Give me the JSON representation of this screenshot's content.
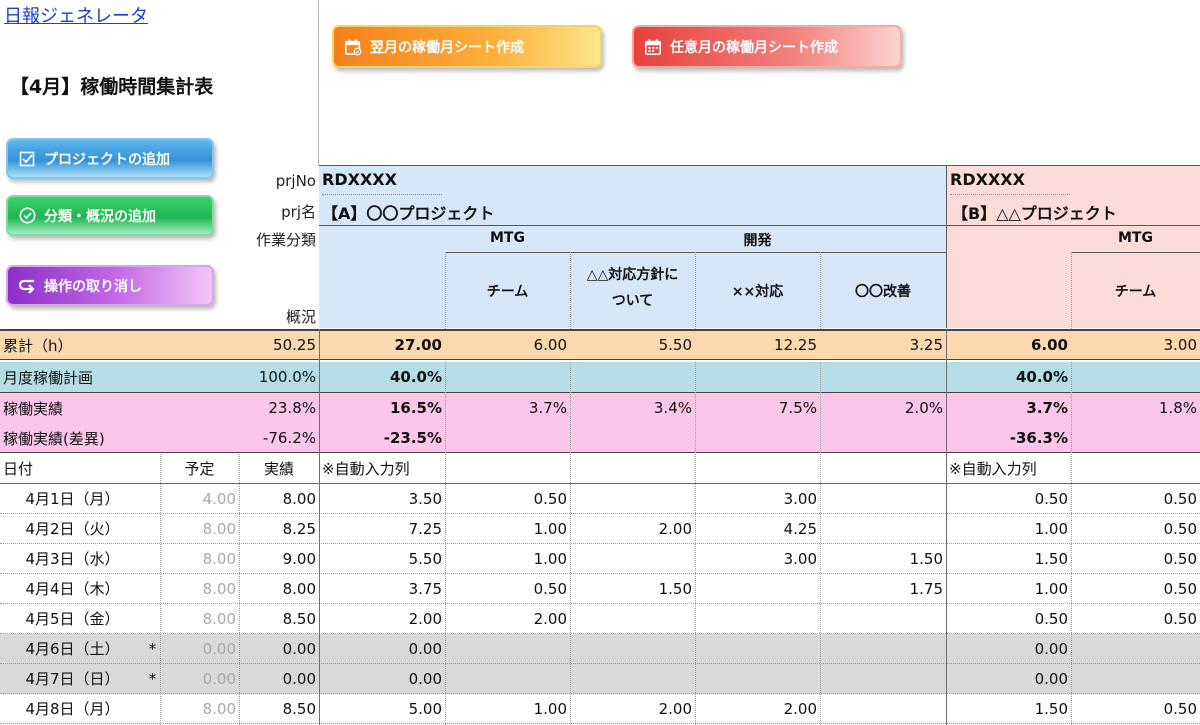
{
  "header": {
    "app_link": "日報ジェネレータ",
    "sheet_title": "【4月】稼働時間集計表"
  },
  "buttons": {
    "add_project": "プロジェクトの追加",
    "add_category": "分類・概況の追加",
    "undo": "操作の取り消し",
    "next_month_sheet": "翌月の稼働月シート作成",
    "any_month_sheet": "任意月の稼働月シート作成"
  },
  "labels": {
    "prj_no": "prjNo",
    "prj_name": "prj名",
    "work_category": "作業分類",
    "status": "概況"
  },
  "projects": {
    "a": {
      "no": "RDXXXX",
      "name": "【A】〇〇プロジェクト"
    },
    "b": {
      "no": "RDXXXX",
      "name": "【B】△△プロジェクト"
    }
  },
  "categories": {
    "a_mtg": "MTG",
    "a_dev": "開発",
    "b_mtg": "MTG"
  },
  "statuses": {
    "a_team": "チーム",
    "a_policy": "△△対応方針に\nついて",
    "a_xx": "××対応",
    "a_oo": "〇〇改善",
    "b_team": "チーム"
  },
  "summary": {
    "total": {
      "label": "累計（h）",
      "sum": "50.25",
      "a_total": "27.00",
      "a_team": "6.00",
      "a_policy": "5.50",
      "a_xx": "12.25",
      "a_oo": "3.25",
      "b_total": "6.00",
      "b_team": "3.00"
    },
    "plan": {
      "label": "月度稼働計画",
      "sum": "100.0%",
      "a_total": "40.0%",
      "b_total": "40.0%"
    },
    "actual": {
      "label": "稼働実績",
      "sum": "23.8%",
      "a_total": "16.5%",
      "a_team": "3.7%",
      "a_policy": "3.4%",
      "a_xx": "7.5%",
      "a_oo": "2.0%",
      "b_total": "3.7%",
      "b_team": "1.8%"
    },
    "diff": {
      "label": "稼働実績(差異)",
      "sum": "-76.2%",
      "a_total": "-23.5%",
      "b_total": "-36.3%"
    }
  },
  "table_header": {
    "date": "日付",
    "planned": "予定",
    "actual": "実績",
    "auto_a": "※自動入力列",
    "auto_b": "※自動入力列"
  },
  "days": [
    {
      "date": "4月1日（月）",
      "mark": "",
      "planned": "4.00",
      "actual": "8.00",
      "a_total": "3.50",
      "a_team": "0.50",
      "a_policy": "",
      "a_xx": "3.00",
      "a_oo": "",
      "b_total": "0.50",
      "b_team": "0.50"
    },
    {
      "date": "4月2日（火）",
      "mark": "",
      "planned": "8.00",
      "actual": "8.25",
      "a_total": "7.25",
      "a_team": "1.00",
      "a_policy": "2.00",
      "a_xx": "4.25",
      "a_oo": "",
      "b_total": "1.00",
      "b_team": "0.50"
    },
    {
      "date": "4月3日（水）",
      "mark": "",
      "planned": "8.00",
      "actual": "9.00",
      "a_total": "5.50",
      "a_team": "1.00",
      "a_policy": "",
      "a_xx": "3.00",
      "a_oo": "1.50",
      "b_total": "1.50",
      "b_team": "0.50"
    },
    {
      "date": "4月4日（木）",
      "mark": "",
      "planned": "8.00",
      "actual": "8.00",
      "a_total": "3.75",
      "a_team": "0.50",
      "a_policy": "1.50",
      "a_xx": "",
      "a_oo": "1.75",
      "b_total": "1.00",
      "b_team": "0.50"
    },
    {
      "date": "4月5日（金）",
      "mark": "",
      "planned": "8.00",
      "actual": "8.50",
      "a_total": "2.00",
      "a_team": "2.00",
      "a_policy": "",
      "a_xx": "",
      "a_oo": "",
      "b_total": "0.50",
      "b_team": "0.50"
    },
    {
      "date": "4月6日（土）",
      "mark": "*",
      "planned": "0.00",
      "actual": "0.00",
      "a_total": "0.00",
      "a_team": "",
      "a_policy": "",
      "a_xx": "",
      "a_oo": "",
      "b_total": "0.00",
      "b_team": ""
    },
    {
      "date": "4月7日（日）",
      "mark": "*",
      "planned": "0.00",
      "actual": "0.00",
      "a_total": "0.00",
      "a_team": "",
      "a_policy": "",
      "a_xx": "",
      "a_oo": "",
      "b_total": "0.00",
      "b_team": ""
    },
    {
      "date": "4月8日（月）",
      "mark": "",
      "planned": "8.00",
      "actual": "8.50",
      "a_total": "5.00",
      "a_team": "1.00",
      "a_policy": "2.00",
      "a_xx": "2.00",
      "a_oo": "",
      "b_total": "1.50",
      "b_team": "0.50"
    }
  ],
  "weekend": [
    false,
    false,
    false,
    false,
    false,
    true,
    true,
    false
  ],
  "colors": {
    "project_a_header": "#d6e7fa",
    "project_b_header": "#fbdcd9",
    "total_row": "#fbd8ad",
    "plan_row": "#b5dde8",
    "actual_row": "#fbc6ea",
    "weekend_row": "#d9d9d9",
    "link": "#1a3fd1"
  }
}
